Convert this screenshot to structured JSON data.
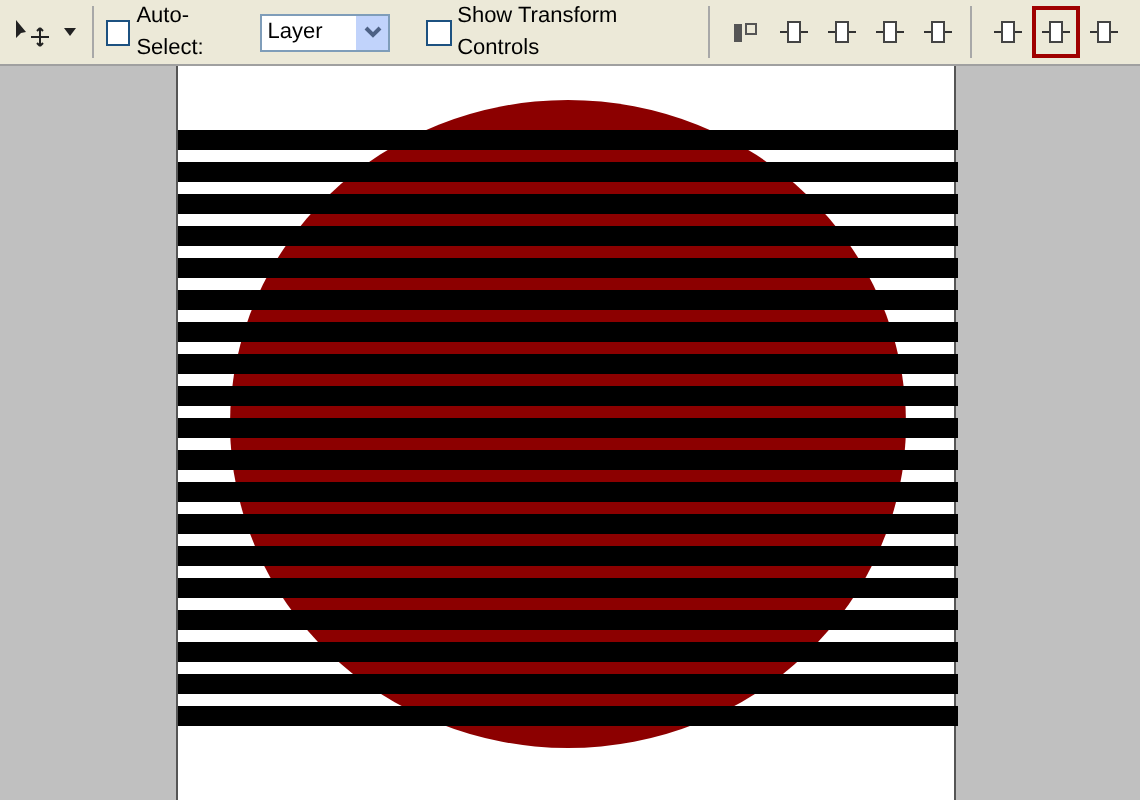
{
  "toolbar": {
    "auto_select": {
      "label": "Auto-Select:",
      "checked": false,
      "value": "Layer"
    },
    "show_transform_controls": {
      "label": "Show Transform Controls",
      "checked": false
    },
    "align_buttons": [
      {
        "selected": false
      },
      {
        "selected": false
      },
      {
        "selected": false
      },
      {
        "selected": false
      },
      {
        "selected": false
      }
    ],
    "distribute_buttons": [
      {
        "selected": false
      },
      {
        "selected": true
      },
      {
        "selected": false
      }
    ]
  }
}
